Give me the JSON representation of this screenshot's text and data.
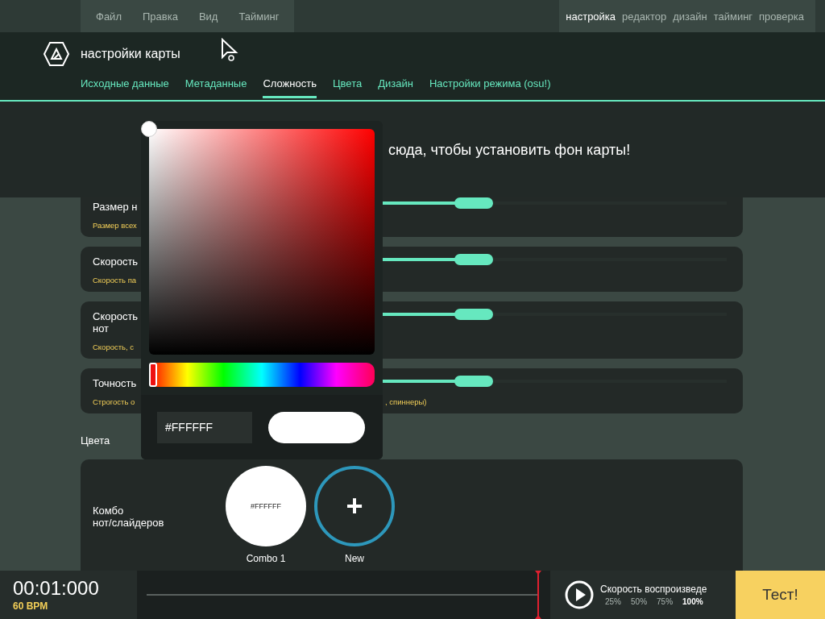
{
  "menu": [
    {
      "label": "Файл"
    },
    {
      "label": "Правка"
    },
    {
      "label": "Вид"
    },
    {
      "label": "Тайминг"
    }
  ],
  "screens": [
    {
      "label": "настройка",
      "selected": true
    },
    {
      "label": "редактор",
      "selected": false
    },
    {
      "label": "дизайн",
      "selected": false
    },
    {
      "label": "тайминг",
      "selected": false
    },
    {
      "label": "проверка",
      "selected": false
    }
  ],
  "header": {
    "title": "настройки карты"
  },
  "tabs": [
    {
      "label": "Исходные данные",
      "selected": false
    },
    {
      "label": "Метаданные",
      "selected": false
    },
    {
      "label": "Сложность",
      "selected": true
    },
    {
      "label": "Цвета",
      "selected": false
    },
    {
      "label": "Дизайн",
      "selected": false
    },
    {
      "label": "Настройки режима (osu!)",
      "selected": false
    }
  ],
  "background_banner": {
    "text": "сюда, чтобы установить фон карты!"
  },
  "difficulty_rows": [
    {
      "label": "Размер н",
      "description": "Размер всех",
      "level": 0.27
    },
    {
      "label": "Скорость",
      "description": "Скорость па",
      "level": 0.27
    },
    {
      "label": "Скорость\nнот",
      "description": "Скорость, с",
      "level": 0.27
    },
    {
      "label": "Точность",
      "description": "Строгость о",
      "description_tail": ", спиннеры)",
      "level": 0.27
    }
  ],
  "colors_section": {
    "title": "Цвета",
    "row_label": "Комбо\nнот/слайдеров",
    "combos": [
      {
        "kind": "color",
        "color": "#ffffff",
        "hex": "#FFFFFF",
        "caption": "Combo 1"
      },
      {
        "kind": "add",
        "symbol": "+",
        "caption": "New"
      }
    ]
  },
  "color_picker": {
    "hex": "#FFFFFF",
    "color": "#ffffff",
    "hue": {
      "level": 0
    }
  },
  "bottom_bar": {
    "time": "00:01:000",
    "bpm": "60 BPM",
    "playback_label": "Скорость воспроизведе",
    "rates": [
      {
        "label": "25%",
        "selected": false
      },
      {
        "label": "50%",
        "selected": false
      },
      {
        "label": "75%",
        "selected": false
      },
      {
        "label": "100%",
        "selected": true
      }
    ],
    "test_button": "Тест!"
  }
}
